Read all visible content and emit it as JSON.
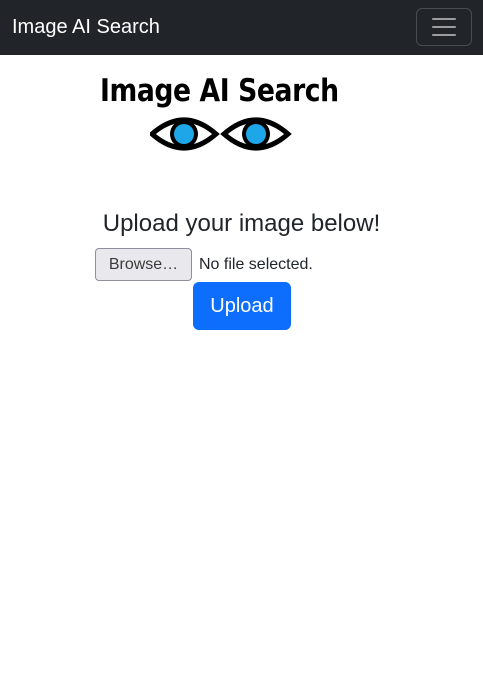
{
  "navbar": {
    "brand": "Image AI Search",
    "toggler_icon": "hamburger-menu-icon",
    "background": "#212529"
  },
  "logo": {
    "text": "Image AI Search",
    "icon": "eyes-icon",
    "iris_color": "#1ea7e8"
  },
  "main": {
    "heading": "Upload your image below!",
    "file_input": {
      "button_label": "Browse…",
      "status": "No file selected."
    },
    "upload_button": {
      "label": "Upload",
      "color": "#0d6efd"
    }
  }
}
